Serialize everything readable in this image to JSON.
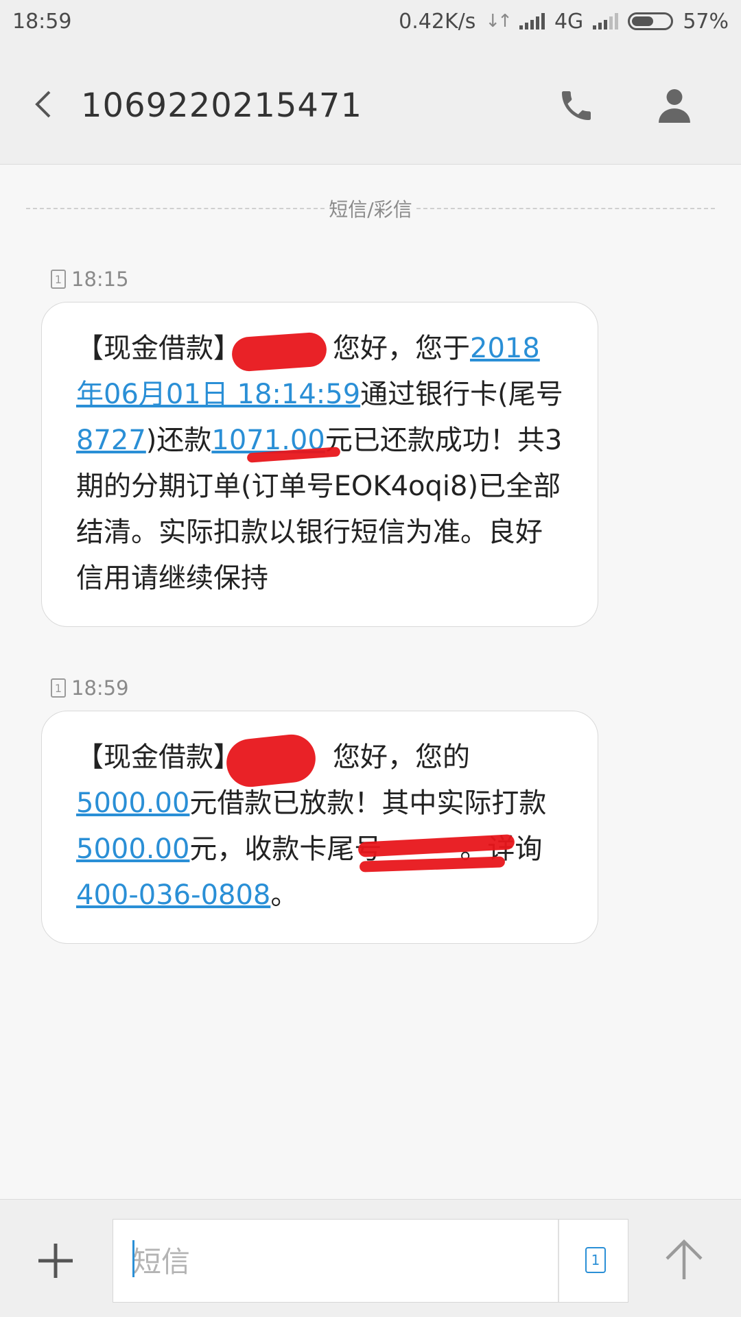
{
  "status_bar": {
    "time": "18:59",
    "net_speed": "0.42K/s",
    "network": "4G",
    "battery": "57%",
    "battery_level": 0.57
  },
  "header": {
    "contact": "1069220215471"
  },
  "divider": {
    "label": "短信/彩信"
  },
  "messages": [
    {
      "time": "18:15",
      "sim": "1",
      "segments": {
        "s1": "【现金借款】",
        "s2": "您好，您于",
        "link_date": "2018年06月01日 18:14:59",
        "s3": "通过银行卡(尾号",
        "link_card": "8727",
        "s4": ")还款",
        "link_amount": "1071.00",
        "s5": "元已还款成功！共3期的分期订单(订单号EOK4oqi8)已全部结清。实际扣款以银行短信为准。良好信用请继续保持"
      }
    },
    {
      "time": "18:59",
      "sim": "1",
      "segments": {
        "s1": "【现金借款】",
        "s2": "您好，您的",
        "link_amount1": "5000.00",
        "s3": "元借款已放款！其中实际打款",
        "link_amount2": "5000.00",
        "s4": "元，收款卡尾号",
        "s5": "。详询",
        "link_phone": "400-036-0808",
        "s6": "。"
      }
    }
  ],
  "compose": {
    "placeholder": "短信",
    "sim": "1"
  },
  "colors": {
    "link": "#2a8fd6",
    "redaction": "#e8161b",
    "background": "#f7f7f7"
  },
  "icons": [
    "back-arrow-icon",
    "phone-icon",
    "person-icon",
    "sim-card-icon",
    "add-icon",
    "send-arrow-icon"
  ]
}
